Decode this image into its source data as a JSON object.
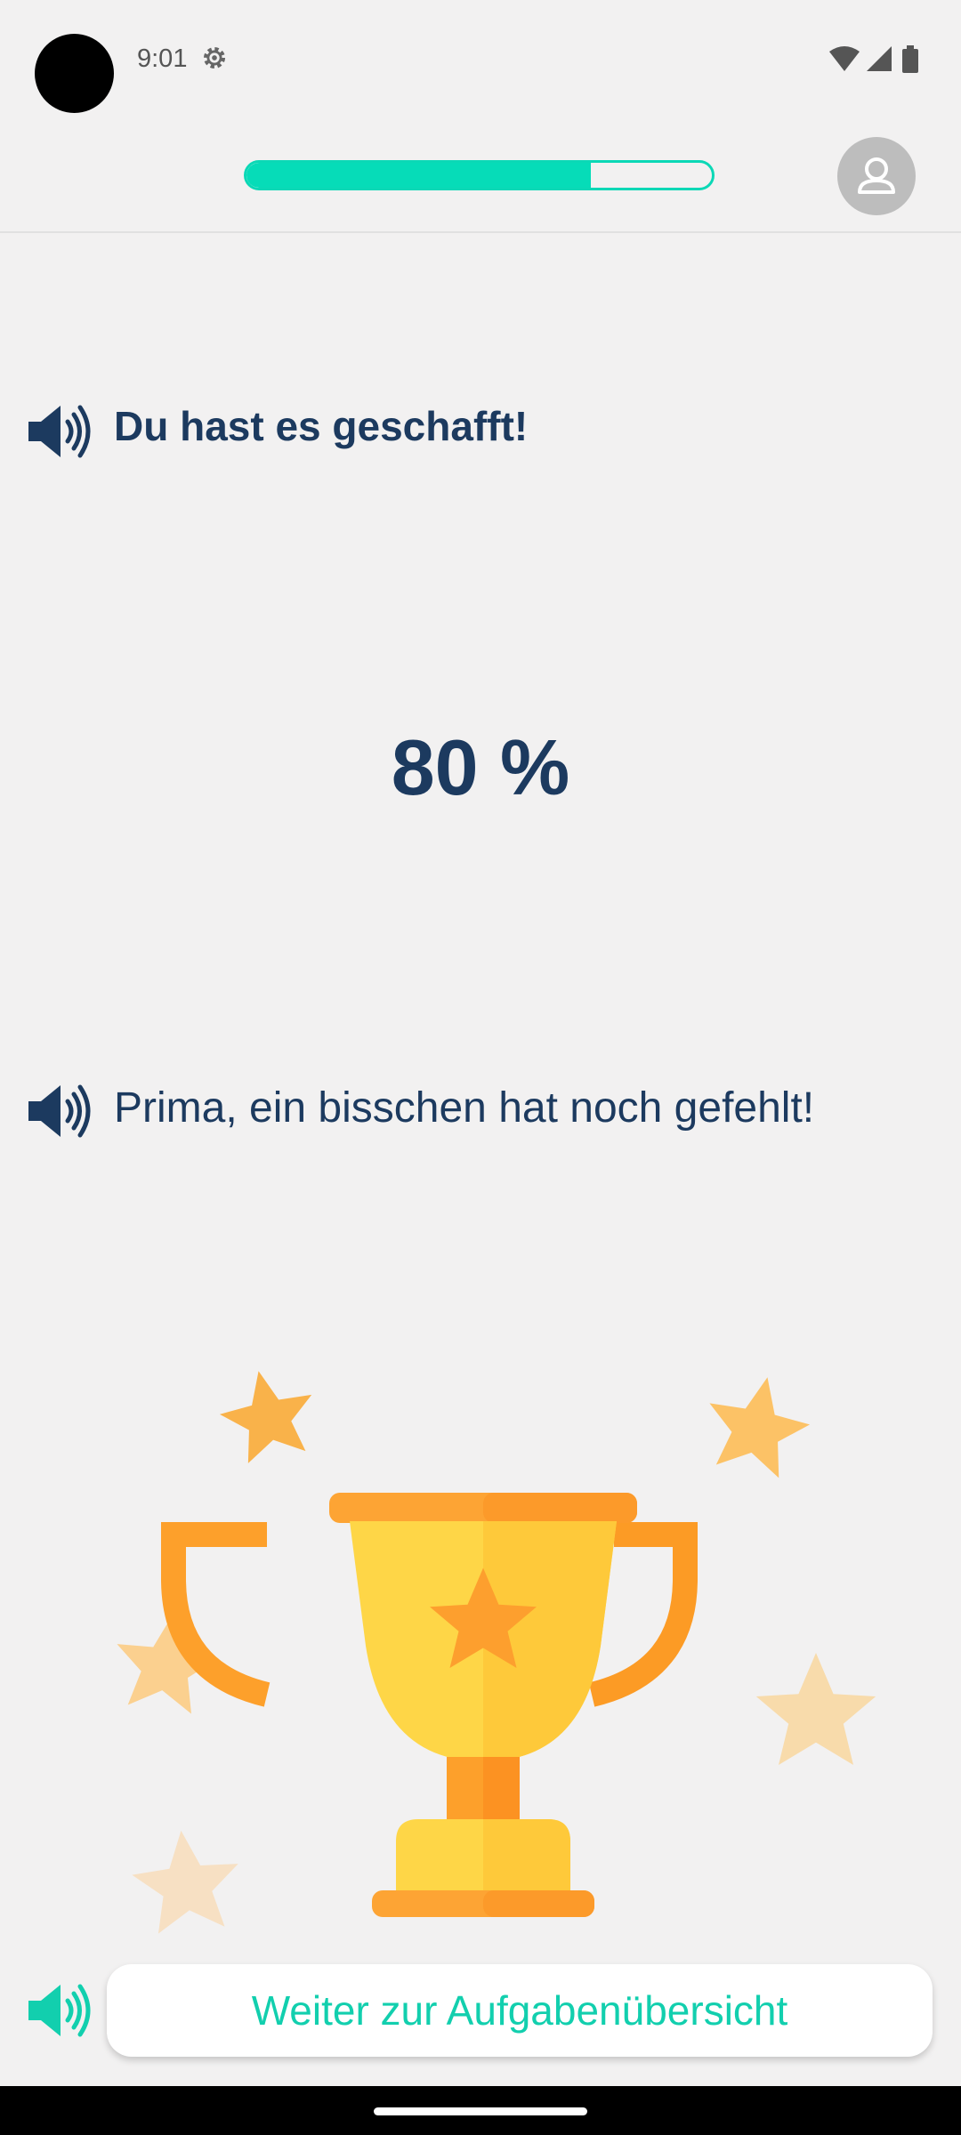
{
  "status_bar": {
    "time": "9:01",
    "icons": [
      "settings-icon",
      "wifi-icon",
      "signal-icon",
      "battery-icon"
    ]
  },
  "top_bar": {
    "progress_fraction": 0.74,
    "progress_color": "#06dcb8",
    "profile_icon": "user-icon"
  },
  "result": {
    "heading": "Du hast es geschafft!",
    "score": "80 %",
    "message": "Prima, ein bisschen hat noch gefehlt!"
  },
  "illustration": {
    "name": "trophy-with-stars"
  },
  "footer": {
    "continue_label": "Weiter zur Aufgabenübersicht"
  },
  "colors": {
    "text_primary": "#1c3a5f",
    "accent": "#12cfae",
    "background": "#f2f1f1"
  }
}
